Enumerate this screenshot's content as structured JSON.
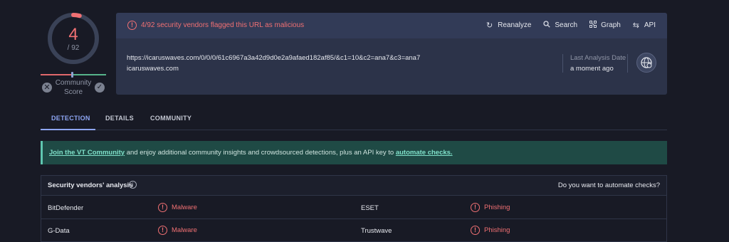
{
  "score": {
    "detections": "4",
    "total": "/ 92",
    "label_line1": "Community",
    "label_line2": "Score",
    "detection_fraction": 0.043
  },
  "colors": {
    "malicious": "#f07073",
    "accent": "#8ea6f4",
    "banner": "#1f4a45"
  },
  "header": {
    "alert": "4/92 security vendors flagged this URL as malicious",
    "alert_icon": "alert-circle-icon",
    "actions": [
      {
        "label": "Reanalyze",
        "icon": "refresh-icon"
      },
      {
        "label": "Search",
        "icon": "search-icon"
      },
      {
        "label": "Graph",
        "icon": "graph-icon"
      },
      {
        "label": "API",
        "icon": "api-icon"
      }
    ],
    "url": "https://icaruswaves.com/0/0/0/61c6967a3a42d9d0e2a9afaed182af85/&c1=10&c2=ana7&c3=ana7",
    "domain": "icaruswaves.com",
    "last_analysis_label": "Last Analysis Date",
    "last_analysis_value": "a moment ago"
  },
  "tabs": [
    {
      "label": "DETECTION",
      "active": true
    },
    {
      "label": "DETAILS",
      "active": false
    },
    {
      "label": "COMMUNITY",
      "active": false
    }
  ],
  "banner": {
    "link1": "Join the VT Community",
    "middle": " and enjoy additional community insights and crowdsourced detections, plus an API key to ",
    "link2": "automate checks."
  },
  "vendors": {
    "title": "Security vendors' analysis",
    "automate_prompt": "Do you want to automate checks?",
    "rows": [
      {
        "left_vendor": "BitDefender",
        "left_result": "Malware",
        "right_vendor": "ESET",
        "right_result": "Phishing"
      },
      {
        "left_vendor": "G-Data",
        "left_result": "Malware",
        "right_vendor": "Trustwave",
        "right_result": "Phishing"
      }
    ]
  }
}
